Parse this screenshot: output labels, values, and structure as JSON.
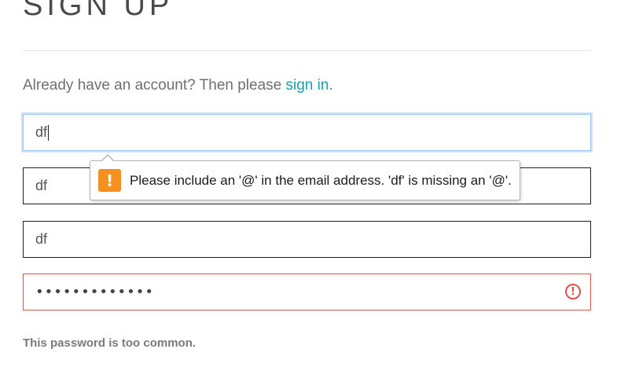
{
  "heading": "SIGN UP",
  "signin_prompt": {
    "text": "Already have an account? Then please ",
    "link_label": "sign in",
    "suffix": "."
  },
  "fields": {
    "email": {
      "value": "df"
    },
    "field_2": {
      "value": "df"
    },
    "field_3": {
      "value": "df"
    },
    "password": {
      "masked_value": "•••••••••••••"
    }
  },
  "validation_tooltip": {
    "icon_glyph": "!",
    "message": "Please include an '@' in the email address. 'df' is missing an '@'."
  },
  "password_error": {
    "icon_glyph": "!",
    "message": "This password is too common."
  },
  "colors": {
    "link": "#1aa0a6",
    "error": "#d9534f",
    "warning": "#f5901e",
    "focus": "#9dc6ef"
  }
}
